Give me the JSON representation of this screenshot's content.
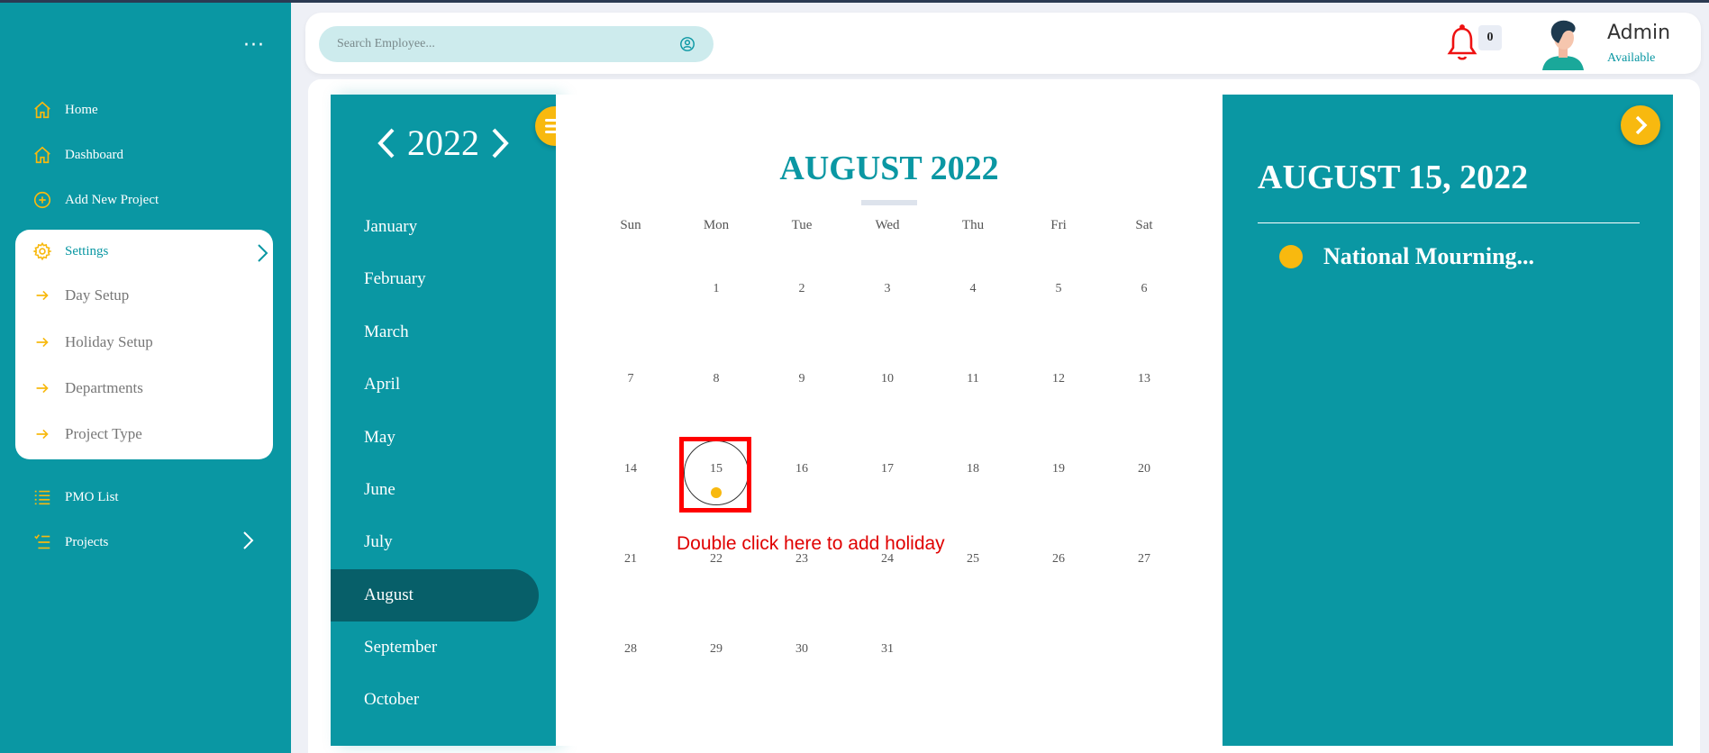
{
  "sidebar": {
    "more": "···",
    "items": [
      {
        "label": "Home",
        "icon": "home-icon"
      },
      {
        "label": "Dashboard",
        "icon": "home-icon"
      },
      {
        "label": "Add New Project",
        "icon": "plus-circle-icon"
      }
    ],
    "settings": {
      "label": "Settings",
      "icon": "gear-icon",
      "subitems": [
        "Day Setup",
        "Holiday Setup",
        "Departments",
        "Project Type"
      ]
    },
    "pmo_list": "PMO List",
    "projects": "Projects"
  },
  "topbar": {
    "search_placeholder": "Search Employee...",
    "notification_count": "0",
    "user_name": "Admin",
    "user_status": "Available"
  },
  "calendar": {
    "year": "2022",
    "months": [
      "January",
      "February",
      "March",
      "April",
      "May",
      "June",
      "July",
      "August",
      "September",
      "October"
    ],
    "active_month": "August",
    "title": "AUGUST 2022",
    "weekdays": [
      "Sun",
      "Mon",
      "Tue",
      "Wed",
      "Thu",
      "Fri",
      "Sat"
    ],
    "weeks": [
      [
        "",
        "1",
        "2",
        "3",
        "4",
        "5",
        "6"
      ],
      [
        "7",
        "8",
        "9",
        "10",
        "11",
        "12",
        "13"
      ],
      [
        "14",
        "15",
        "16",
        "17",
        "18",
        "19",
        "20"
      ],
      [
        "21",
        "22",
        "23",
        "24",
        "25",
        "26",
        "27"
      ],
      [
        "28",
        "29",
        "30",
        "31",
        "",
        "",
        ""
      ]
    ],
    "selected_day": "15",
    "annotation": "Double click here to add holiday"
  },
  "events": {
    "date": "AUGUST 15, 2022",
    "items": [
      "National Mourning..."
    ]
  },
  "colors": {
    "teal": "#0a97a3",
    "dark_teal": "#075f69",
    "accent": "#f8b90f",
    "annotation_red": "#ff0000"
  }
}
